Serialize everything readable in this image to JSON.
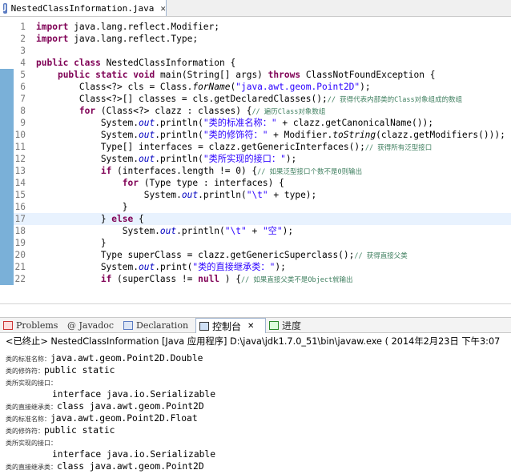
{
  "editor": {
    "tab_label": "NestedClassInformation.java",
    "tab_close": "✕",
    "lines": [
      {
        "n": "1",
        "marker": false,
        "segs": [
          [
            "kw",
            "import"
          ],
          [
            "",
            "java.lang.reflect.Modifier;"
          ]
        ]
      },
      {
        "n": "2",
        "marker": false,
        "segs": [
          [
            "kw",
            "import"
          ],
          [
            "",
            "java.lang.reflect.Type;"
          ]
        ]
      },
      {
        "n": "3",
        "marker": false,
        "segs": []
      },
      {
        "n": "4",
        "marker": false,
        "segs": [
          [
            "kw",
            "public class"
          ],
          [
            "",
            "NestedClassInformation {"
          ]
        ]
      },
      {
        "n": "5",
        "marker": true,
        "segs": [
          [
            "",
            "    "
          ],
          [
            "kw",
            "public static void"
          ],
          [
            "",
            " main(String[] args) "
          ],
          [
            "kw",
            "throws"
          ],
          [
            "",
            " ClassNotFoundException {"
          ]
        ]
      },
      {
        "n": "6",
        "marker": true,
        "segs": [
          [
            "",
            "        Class<?> cls = Class."
          ],
          [
            "it",
            "forName"
          ],
          [
            "",
            "("
          ],
          [
            "str",
            "\"java.awt.geom.Point2D\""
          ],
          [
            "",
            ");"
          ]
        ]
      },
      {
        "n": "7",
        "marker": true,
        "segs": [
          [
            "",
            "        Class<?>[] classes = cls.getDeclaredClasses();"
          ],
          [
            "cmt",
            "// 获得代表内部类的Class对象组成的数组"
          ]
        ]
      },
      {
        "n": "8",
        "marker": true,
        "segs": [
          [
            "",
            "        "
          ],
          [
            "kw",
            "for"
          ],
          [
            "",
            " (Class<?> clazz : classes) {"
          ],
          [
            "cmt",
            "// 遍历Class对象数组"
          ]
        ]
      },
      {
        "n": "9",
        "marker": true,
        "segs": [
          [
            "",
            "            System."
          ],
          [
            "fld",
            "out"
          ],
          [
            "",
            ".println("
          ],
          [
            "str",
            "\"类的标准名称：\""
          ],
          [
            "",
            " + clazz.getCanonicalName());"
          ]
        ]
      },
      {
        "n": "10",
        "marker": true,
        "segs": [
          [
            "",
            "            System."
          ],
          [
            "fld",
            "out"
          ],
          [
            "",
            ".println("
          ],
          [
            "str",
            "\"类的修饰符：\""
          ],
          [
            "",
            " + Modifier."
          ],
          [
            "it",
            "toString"
          ],
          [
            "",
            "(clazz.getModifiers()));"
          ]
        ]
      },
      {
        "n": "11",
        "marker": true,
        "segs": [
          [
            "",
            "            Type[] interfaces = clazz.getGenericInterfaces();"
          ],
          [
            "cmt",
            "// 获得所有泛型接口"
          ]
        ]
      },
      {
        "n": "12",
        "marker": true,
        "segs": [
          [
            "",
            "            System."
          ],
          [
            "fld",
            "out"
          ],
          [
            "",
            ".println("
          ],
          [
            "str",
            "\"类所实现的接口：\""
          ],
          [
            "",
            ");"
          ]
        ]
      },
      {
        "n": "13",
        "marker": true,
        "segs": [
          [
            "",
            "            "
          ],
          [
            "kw",
            "if"
          ],
          [
            "",
            " (interfaces.length != 0) {"
          ],
          [
            "cmt",
            "// 如果泛型接口个数不是0则输出"
          ]
        ]
      },
      {
        "n": "14",
        "marker": true,
        "segs": [
          [
            "",
            "                "
          ],
          [
            "kw",
            "for"
          ],
          [
            "",
            " (Type type : interfaces) {"
          ]
        ]
      },
      {
        "n": "15",
        "marker": true,
        "segs": [
          [
            "",
            "                    System."
          ],
          [
            "fld",
            "out"
          ],
          [
            "",
            ".println("
          ],
          [
            "str",
            "\"\\t\""
          ],
          [
            "",
            " + type);"
          ]
        ]
      },
      {
        "n": "16",
        "marker": true,
        "segs": [
          [
            "",
            "                }"
          ]
        ]
      },
      {
        "n": "17",
        "marker": true,
        "hl": true,
        "segs": [
          [
            "",
            "            } "
          ],
          [
            "kw",
            "else"
          ],
          [
            "",
            " {"
          ]
        ]
      },
      {
        "n": "18",
        "marker": true,
        "segs": [
          [
            "",
            "                System."
          ],
          [
            "fld",
            "out"
          ],
          [
            "",
            ".println("
          ],
          [
            "str",
            "\"\\t\""
          ],
          [
            "",
            " + "
          ],
          [
            "str",
            "\"空\""
          ],
          [
            "",
            ");"
          ]
        ]
      },
      {
        "n": "19",
        "marker": true,
        "segs": [
          [
            "",
            "            }"
          ]
        ]
      },
      {
        "n": "20",
        "marker": true,
        "segs": [
          [
            "",
            "            Type superClass = clazz.getGenericSuperclass();"
          ],
          [
            "cmt",
            "// 获得直接父类"
          ]
        ]
      },
      {
        "n": "21",
        "marker": true,
        "segs": [
          [
            "",
            "            System."
          ],
          [
            "fld",
            "out"
          ],
          [
            "",
            ".print("
          ],
          [
            "str",
            "\"类的直接继承类：\""
          ],
          [
            "",
            ");"
          ]
        ]
      },
      {
        "n": "22",
        "marker": true,
        "segs": [
          [
            "",
            "            "
          ],
          [
            "kw",
            "if"
          ],
          [
            "",
            " (superClass != "
          ],
          [
            "kw",
            "null"
          ],
          [
            "",
            ") {"
          ],
          [
            "cmt",
            "// 如果直接父类不是Object就输出"
          ]
        ]
      }
    ]
  },
  "views": {
    "tabs": [
      "Problems",
      "@ Javadoc",
      "Declaration",
      "控制台",
      "✕",
      "进度"
    ]
  },
  "console": {
    "header": "<已终止> NestedClassInformation [Java 应用程序] D:\\java\\jdk1.7.0_51\\bin\\javaw.exe ( 2014年2月23日 下午3:07",
    "lines": [
      {
        "label": "类的标准名称：",
        "value": "java.awt.geom.Point2D.Double"
      },
      {
        "label": "类的修饰符：",
        "value": "public static"
      },
      {
        "label": "类所实现的接口：",
        "value": ""
      },
      {
        "label": "",
        "value": "interface java.io.Serializable"
      },
      {
        "label": "类的直接继承类：",
        "value": "class java.awt.geom.Point2D"
      },
      {
        "label": "类的标准名称：",
        "value": "java.awt.geom.Point2D.Float"
      },
      {
        "label": "类的修饰符：",
        "value": "public static"
      },
      {
        "label": "类所实现的接口：",
        "value": ""
      },
      {
        "label": "",
        "value": "interface java.io.Serializable"
      },
      {
        "label": "类的直接继承类：",
        "value": "class java.awt.geom.Point2D"
      }
    ]
  }
}
